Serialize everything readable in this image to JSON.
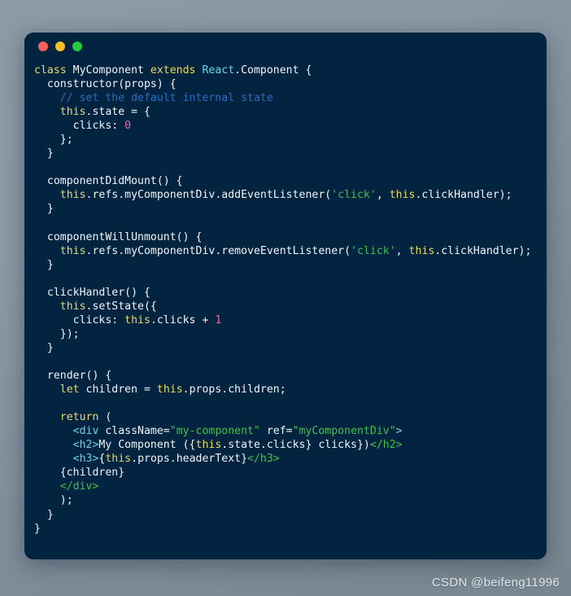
{
  "window": {
    "traffic_lights": [
      {
        "name": "close",
        "color": "#f9605c"
      },
      {
        "name": "minimize",
        "color": "#f9bd2e"
      },
      {
        "name": "maximize",
        "color": "#27c93f"
      }
    ],
    "background_color": "#022441"
  },
  "desktop": {
    "background_color": "#8b98a5"
  },
  "watermark": {
    "text": "CSDN @beifeng11996"
  },
  "code": {
    "language": "jsx",
    "lines": [
      [
        {
          "t": "class ",
          "c": "kw"
        },
        {
          "t": "MyComponent ",
          "c": "plain"
        },
        {
          "t": "extends ",
          "c": "kw"
        },
        {
          "t": "React",
          "c": "cls"
        },
        {
          "t": ".Component {",
          "c": "plain"
        }
      ],
      [
        {
          "t": "  constructor(props) {",
          "c": "plain"
        }
      ],
      [
        {
          "t": "    // set the default internal state",
          "c": "cmt"
        }
      ],
      [
        {
          "t": "    ",
          "c": "plain"
        },
        {
          "t": "this",
          "c": "this"
        },
        {
          "t": ".state = {",
          "c": "plain"
        }
      ],
      [
        {
          "t": "      clicks: ",
          "c": "plain"
        },
        {
          "t": "0",
          "c": "num"
        }
      ],
      [
        {
          "t": "    };",
          "c": "plain"
        }
      ],
      [
        {
          "t": "  }",
          "c": "plain"
        }
      ],
      [
        {
          "t": "",
          "c": "plain"
        }
      ],
      [
        {
          "t": "  componentDidMount() {",
          "c": "plain"
        }
      ],
      [
        {
          "t": "    ",
          "c": "plain"
        },
        {
          "t": "this",
          "c": "this"
        },
        {
          "t": ".refs.myComponentDiv.addEventListener(",
          "c": "plain"
        },
        {
          "t": "'click'",
          "c": "str"
        },
        {
          "t": ", ",
          "c": "plain"
        },
        {
          "t": "this",
          "c": "this"
        },
        {
          "t": ".clickHandler);",
          "c": "plain"
        }
      ],
      [
        {
          "t": "  }",
          "c": "plain"
        }
      ],
      [
        {
          "t": "",
          "c": "plain"
        }
      ],
      [
        {
          "t": "  componentWillUnmount() {",
          "c": "plain"
        }
      ],
      [
        {
          "t": "    ",
          "c": "plain"
        },
        {
          "t": "this",
          "c": "this"
        },
        {
          "t": ".refs.myComponentDiv.removeEventListener(",
          "c": "plain"
        },
        {
          "t": "'click'",
          "c": "str"
        },
        {
          "t": ", ",
          "c": "plain"
        },
        {
          "t": "this",
          "c": "this"
        },
        {
          "t": ".clickHandler);",
          "c": "plain"
        }
      ],
      [
        {
          "t": "  }",
          "c": "plain"
        }
      ],
      [
        {
          "t": "",
          "c": "plain"
        }
      ],
      [
        {
          "t": "  clickHandler() {",
          "c": "plain"
        }
      ],
      [
        {
          "t": "    ",
          "c": "plain"
        },
        {
          "t": "this",
          "c": "this"
        },
        {
          "t": ".setState({",
          "c": "plain"
        }
      ],
      [
        {
          "t": "      clicks: ",
          "c": "plain"
        },
        {
          "t": "this",
          "c": "this"
        },
        {
          "t": ".clicks + ",
          "c": "plain"
        },
        {
          "t": "1",
          "c": "num"
        }
      ],
      [
        {
          "t": "    });",
          "c": "plain"
        }
      ],
      [
        {
          "t": "  }",
          "c": "plain"
        }
      ],
      [
        {
          "t": "",
          "c": "plain"
        }
      ],
      [
        {
          "t": "  render() {",
          "c": "plain"
        }
      ],
      [
        {
          "t": "    ",
          "c": "plain"
        },
        {
          "t": "let ",
          "c": "kw"
        },
        {
          "t": "children = ",
          "c": "plain"
        },
        {
          "t": "this",
          "c": "this"
        },
        {
          "t": ".props.children;",
          "c": "plain"
        }
      ],
      [
        {
          "t": "",
          "c": "plain"
        }
      ],
      [
        {
          "t": "    ",
          "c": "plain"
        },
        {
          "t": "return",
          "c": "kw"
        },
        {
          "t": " (",
          "c": "plain"
        }
      ],
      [
        {
          "t": "      ",
          "c": "plain"
        },
        {
          "t": "<div",
          "c": "tago"
        },
        {
          "t": " className=",
          "c": "attr"
        },
        {
          "t": "\"my-component\"",
          "c": "attrv"
        },
        {
          "t": " ref=",
          "c": "attr"
        },
        {
          "t": "\"myComponentDiv\"",
          "c": "attrv"
        },
        {
          "t": ">",
          "c": "tago"
        }
      ],
      [
        {
          "t": "      ",
          "c": "plain"
        },
        {
          "t": "<h2>",
          "c": "tago"
        },
        {
          "t": "My Component ({",
          "c": "plain"
        },
        {
          "t": "this",
          "c": "this"
        },
        {
          "t": ".state.clicks} clicks})",
          "c": "plain"
        },
        {
          "t": "</h2>",
          "c": "tagc"
        }
      ],
      [
        {
          "t": "      ",
          "c": "plain"
        },
        {
          "t": "<h3>",
          "c": "tago"
        },
        {
          "t": "{",
          "c": "plain"
        },
        {
          "t": "this",
          "c": "this"
        },
        {
          "t": ".props.headerText}",
          "c": "plain"
        },
        {
          "t": "</h3>",
          "c": "tagc"
        }
      ],
      [
        {
          "t": "    {children}",
          "c": "plain"
        }
      ],
      [
        {
          "t": "    ",
          "c": "plain"
        },
        {
          "t": "</div>",
          "c": "tagc"
        }
      ],
      [
        {
          "t": "    );",
          "c": "plain"
        }
      ],
      [
        {
          "t": "  }",
          "c": "plain"
        }
      ],
      [
        {
          "t": "}",
          "c": "plain"
        }
      ]
    ]
  }
}
